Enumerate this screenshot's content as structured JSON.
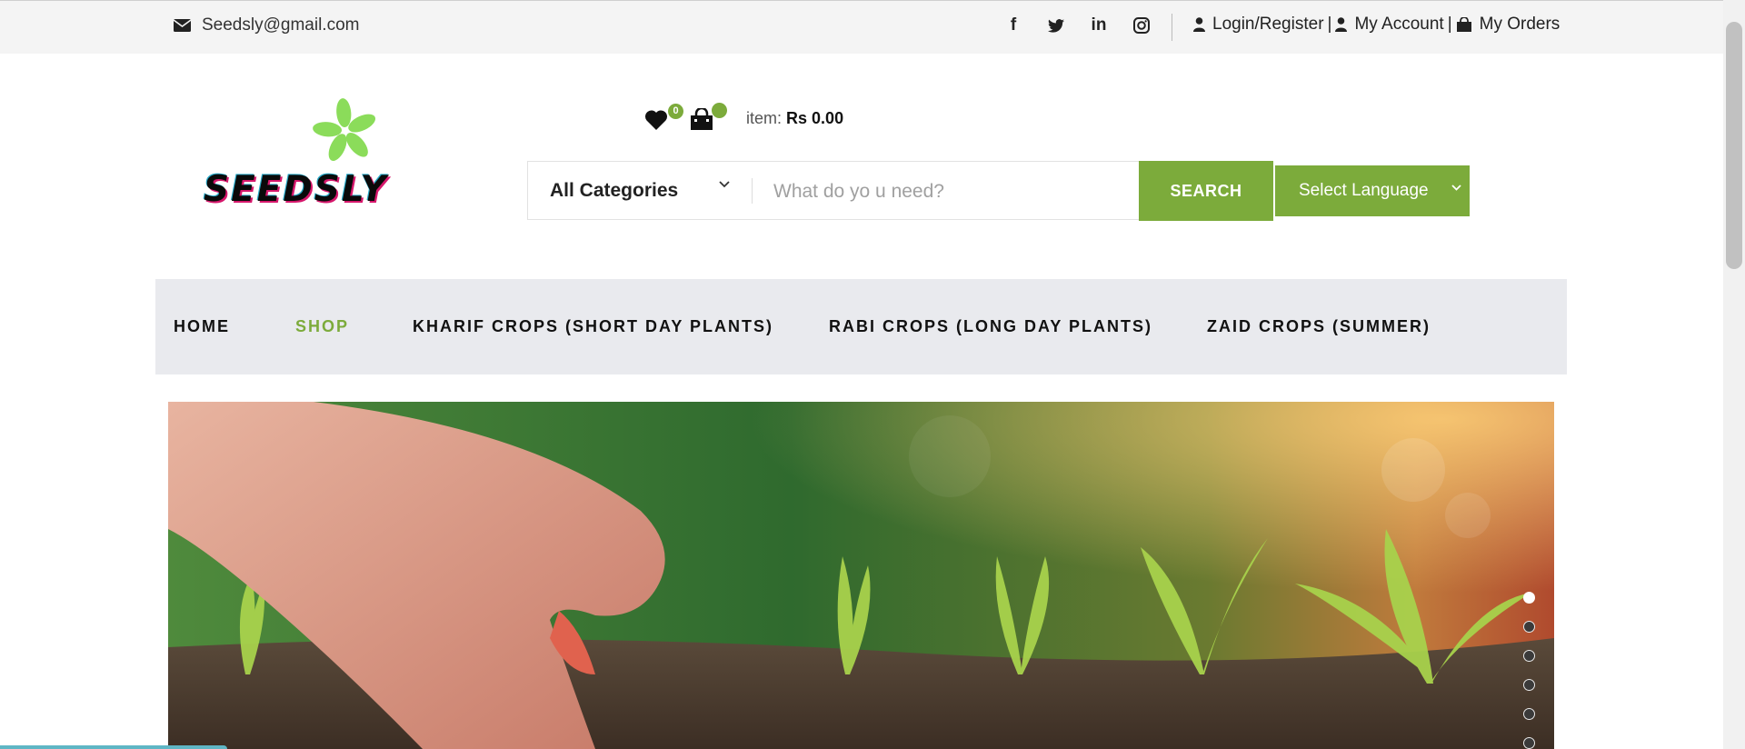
{
  "topbar": {
    "email": "Seedsly@gmail.com",
    "socials": [
      {
        "icon": "facebook-icon",
        "glyph": "f"
      },
      {
        "icon": "twitter-icon",
        "glyph": ""
      },
      {
        "icon": "linkedin-icon",
        "glyph": "in"
      },
      {
        "icon": "instagram-icon",
        "glyph": ""
      }
    ],
    "login": "Login/Register",
    "account": "My Account",
    "orders": "My Orders",
    "separator": "|"
  },
  "logo": {
    "text": "SEEDSLY"
  },
  "header": {
    "wishlist_count": "0",
    "cart_count": "",
    "item_label": "item:",
    "item_total": "Rs 0.00"
  },
  "search": {
    "category": "All Categories",
    "placeholder": "What do yo u need?",
    "button": "SEARCH",
    "language": "Select Language"
  },
  "nav": [
    {
      "label": "HOME",
      "active": false
    },
    {
      "label": "SHOP",
      "active": true
    },
    {
      "label": "KHARIF CROPS (SHORT DAY PLANTS)",
      "active": false
    },
    {
      "label": "RABI CROPS (LONG DAY PLANTS)",
      "active": false
    },
    {
      "label": "ZAID CROPS (SUMMER)",
      "active": false
    }
  ],
  "carousel": {
    "active_index": 0,
    "total_dots": 6
  },
  "colors": {
    "accent": "#7cab3b",
    "nav_bg": "#e9eaee",
    "topbar_bg": "#f4f4f4"
  }
}
